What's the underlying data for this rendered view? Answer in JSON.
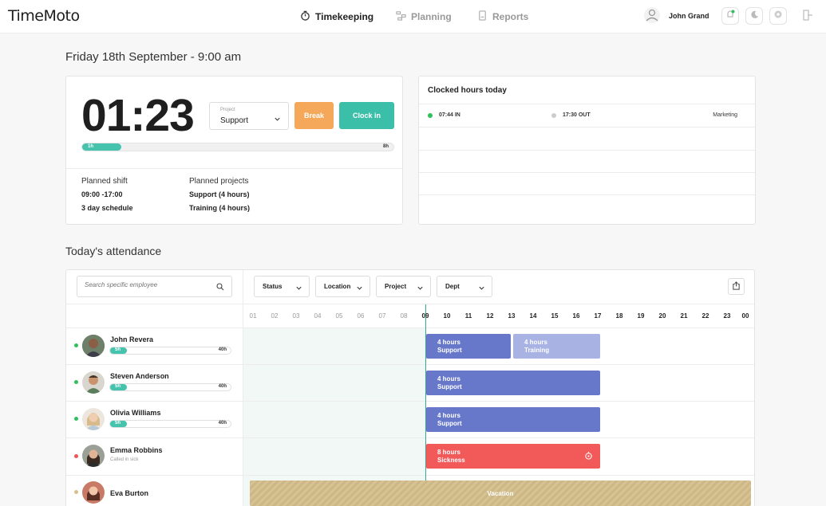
{
  "app": {
    "logo": "TimeMoto",
    "nav": [
      {
        "label": "Timekeeping",
        "icon": "stopwatch-icon",
        "active": true
      },
      {
        "label": "Planning",
        "icon": "planning-icon",
        "active": false
      },
      {
        "label": "Reports",
        "icon": "report-icon",
        "active": false
      }
    ],
    "user_name": "John Grand"
  },
  "date_title": "Friday 18th September - 9:00 am",
  "clock": {
    "timer": "01:23",
    "project_label": "Project",
    "project_value": "Support",
    "break_label": "Break",
    "clockin_label": "Clock in",
    "progress_start": "1h",
    "progress_end": "8h",
    "progress_fraction": 0.125,
    "planned_shift_label": "Planned shift",
    "planned_shift_time": "09:00 -17:00",
    "planned_shift_schedule": "3 day schedule",
    "planned_projects_label": "Planned projects",
    "planned_projects": [
      "Support (4 hours)",
      "Training (4 hours)"
    ]
  },
  "clocked": {
    "title": "Clocked hours today",
    "in": "07:44 IN",
    "out": "17:30 OUT",
    "dept": "Marketing"
  },
  "attendance": {
    "title": "Today's attendance",
    "search_placeholder": "Search specific employee",
    "filters": [
      "Status",
      "Location",
      "Project",
      "Dept"
    ],
    "hours": [
      "01",
      "02",
      "03",
      "04",
      "05",
      "06",
      "07",
      "08",
      "09",
      "10",
      "11",
      "12",
      "13",
      "14",
      "15",
      "16",
      "17",
      "18",
      "19",
      "20",
      "21",
      "22",
      "23",
      "00"
    ],
    "employees": [
      {
        "name": "John Revera",
        "status_color": "#2fbf5b",
        "hours_done": "5h",
        "hours_total": "40h"
      },
      {
        "name": "Steven Anderson",
        "status_color": "#2fbf5b",
        "hours_done": "5h",
        "hours_total": "40h"
      },
      {
        "name": "Olivia Williams",
        "status_color": "#2fbf5b",
        "hours_done": "5h",
        "hours_total": "40h"
      },
      {
        "name": "Emma Robbins",
        "status_color": "#f05454",
        "note": "Called in sick"
      },
      {
        "name": "Eva Burton",
        "status_color": "#d9c08a"
      }
    ],
    "blocks": {
      "john_1": [
        "4 hours",
        "Support"
      ],
      "john_2": [
        "4 hours",
        "Training"
      ],
      "steven": [
        "4 hours",
        "Support"
      ],
      "olivia": [
        "4 hours",
        "Support"
      ],
      "emma": [
        "8 hours",
        "Sickness"
      ],
      "eva": "Vacation"
    }
  },
  "colors": {
    "accent": "#3bbfa8",
    "break": "#f6a85a",
    "support": "#6778cb",
    "training": "#a8b2e3",
    "sickness": "#f25a5a"
  }
}
